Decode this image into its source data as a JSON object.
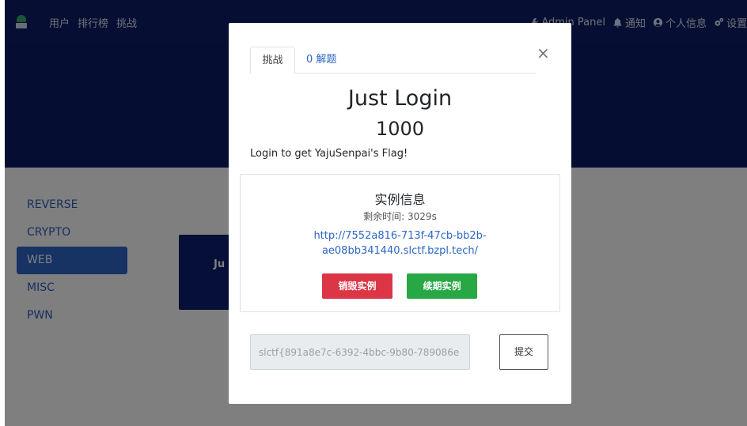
{
  "navbar": {
    "links": [
      "用户",
      "排行榜",
      "挑战"
    ],
    "right": {
      "admin": "Admin Panel",
      "notifications": "通知",
      "profile": "个人信息",
      "settings": "设置"
    }
  },
  "sidebar": {
    "items": [
      {
        "label": "REVERSE"
      },
      {
        "label": "CRYPTO"
      },
      {
        "label": "WEB",
        "active": true
      },
      {
        "label": "MISC"
      },
      {
        "label": "PWN"
      }
    ]
  },
  "card": {
    "title_visible": "Ju"
  },
  "modal": {
    "tabs": {
      "challenge": "挑战",
      "solves": "0 解题"
    },
    "close": "×",
    "title": "Just Login",
    "value": "1000",
    "description": "Login to get YajuSenpai's Flag!",
    "instance": {
      "title": "实例信息",
      "time_left": "剩余时间: 3029s",
      "url_line1": "http://7552a816-713f-47cb-bb2b-",
      "url_line2": "ae08bb341440.slctf.bzpl.tech/",
      "destroy_label": "销毁实例",
      "renew_label": "续期实例"
    },
    "flag_value": "slctf{891a8e7c-6392-4bbc-9b80-789086e",
    "submit_label": "提交"
  },
  "colors": {
    "navbar": "#0c1d66",
    "accent": "#2f66c9",
    "destroy": "#dc3545",
    "renew": "#28a745"
  }
}
